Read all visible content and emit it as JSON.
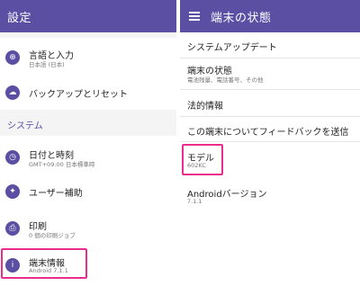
{
  "left_panel": {
    "title": "設定",
    "items_top": [
      {
        "label": "言語と入力",
        "sub": "日本語 (日本)",
        "icon": "globe-icon"
      },
      {
        "label": "バックアップとリセット",
        "sub": "",
        "icon": "cloud-upload-icon"
      }
    ],
    "section_label": "システム",
    "items_bottom": [
      {
        "label": "日付と時刻",
        "sub": "GMT+09:00 日本標準時",
        "icon": "clock-icon"
      },
      {
        "label": "ユーザー補助",
        "sub": "",
        "icon": "accessibility-icon"
      },
      {
        "label": "印刷",
        "sub": "0 個の印刷ジョブ",
        "icon": "printer-icon"
      },
      {
        "label": "端末情報",
        "sub": "Android 7.1.1",
        "icon": "info-icon"
      }
    ]
  },
  "right_panel": {
    "title": "端末の状態",
    "items": [
      {
        "label": "システムアップデート",
        "sub": ""
      },
      {
        "label": "端末の状態",
        "sub": "電池残量、電話番号、その他"
      },
      {
        "label": "法的情報",
        "sub": ""
      },
      {
        "label": "この端末についてフィードバックを送信",
        "sub": ""
      },
      {
        "label": "モデル",
        "sub": "602KC"
      },
      {
        "label": "Androidバージョン",
        "sub": "7.1.1"
      }
    ]
  },
  "colors": {
    "appbar": "#5a4fa3",
    "highlight": "#ea2d8d"
  }
}
